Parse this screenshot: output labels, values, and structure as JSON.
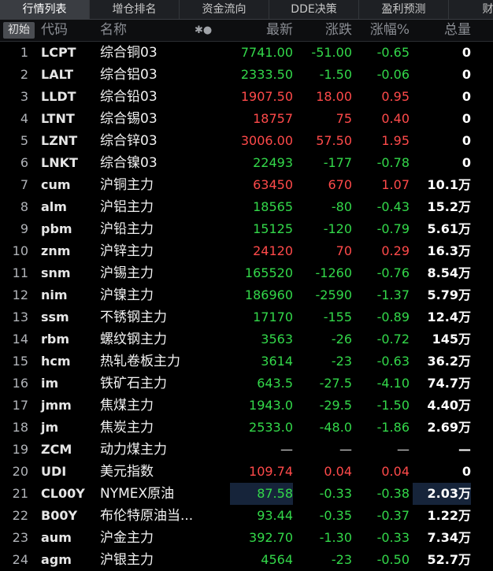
{
  "tabs": [
    "行情列表",
    "增仓排名",
    "资金流向",
    "DDE决策",
    "盈利预测",
    "财务"
  ],
  "header": {
    "init_btn": "初始",
    "code": "代码",
    "name": "名称",
    "icons": "✱●",
    "price": "最新",
    "change": "涨跌",
    "pct": "涨幅%",
    "volume": "总量"
  },
  "colors": {
    "up": "#ff4a4a",
    "down": "#33d84a",
    "highlight": "#16243a"
  },
  "rows": [
    {
      "n": "1",
      "code": "LCPT",
      "name": "综合铜03",
      "price": "7741.00",
      "change": "-51.00",
      "pct": "-0.65",
      "volume": "0",
      "dir": "down"
    },
    {
      "n": "2",
      "code": "LALT",
      "name": "综合铝03",
      "price": "2333.50",
      "change": "-1.50",
      "pct": "-0.06",
      "volume": "0",
      "dir": "down"
    },
    {
      "n": "3",
      "code": "LLDT",
      "name": "综合铅03",
      "price": "1907.50",
      "change": "18.00",
      "pct": "0.95",
      "volume": "0",
      "dir": "up"
    },
    {
      "n": "4",
      "code": "LTNT",
      "name": "综合锡03",
      "price": "18757",
      "change": "75",
      "pct": "0.40",
      "volume": "0",
      "dir": "up"
    },
    {
      "n": "5",
      "code": "LZNT",
      "name": "综合锌03",
      "price": "3006.00",
      "change": "57.50",
      "pct": "1.95",
      "volume": "0",
      "dir": "up"
    },
    {
      "n": "6",
      "code": "LNKT",
      "name": "综合镍03",
      "price": "22493",
      "change": "-177",
      "pct": "-0.78",
      "volume": "0",
      "dir": "down"
    },
    {
      "n": "7",
      "code": "cum",
      "name": "沪铜主力",
      "price": "63450",
      "change": "670",
      "pct": "1.07",
      "volume": "10.1万",
      "dir": "up"
    },
    {
      "n": "8",
      "code": "alm",
      "name": "沪铝主力",
      "price": "18565",
      "change": "-80",
      "pct": "-0.43",
      "volume": "15.2万",
      "dir": "down"
    },
    {
      "n": "9",
      "code": "pbm",
      "name": "沪铅主力",
      "price": "15125",
      "change": "-120",
      "pct": "-0.79",
      "volume": "5.61万",
      "dir": "down"
    },
    {
      "n": "10",
      "code": "znm",
      "name": "沪锌主力",
      "price": "24120",
      "change": "70",
      "pct": "0.29",
      "volume": "16.3万",
      "dir": "up"
    },
    {
      "n": "11",
      "code": "snm",
      "name": "沪锡主力",
      "price": "165520",
      "change": "-1260",
      "pct": "-0.76",
      "volume": "8.54万",
      "dir": "down"
    },
    {
      "n": "12",
      "code": "nim",
      "name": "沪镍主力",
      "price": "186960",
      "change": "-2590",
      "pct": "-1.37",
      "volume": "5.79万",
      "dir": "down"
    },
    {
      "n": "13",
      "code": "ssm",
      "name": "不锈钢主力",
      "price": "17170",
      "change": "-155",
      "pct": "-0.89",
      "volume": "12.4万",
      "dir": "down"
    },
    {
      "n": "14",
      "code": "rbm",
      "name": "螺纹钢主力",
      "price": "3563",
      "change": "-26",
      "pct": "-0.72",
      "volume": "145万",
      "dir": "down"
    },
    {
      "n": "15",
      "code": "hcm",
      "name": "热轧卷板主力",
      "price": "3614",
      "change": "-23",
      "pct": "-0.63",
      "volume": "36.2万",
      "dir": "down"
    },
    {
      "n": "16",
      "code": "im",
      "name": "铁矿石主力",
      "price": "643.5",
      "change": "-27.5",
      "pct": "-4.10",
      "volume": "74.7万",
      "dir": "down"
    },
    {
      "n": "17",
      "code": "jmm",
      "name": "焦煤主力",
      "price": "1943.0",
      "change": "-29.5",
      "pct": "-1.50",
      "volume": "4.40万",
      "dir": "down"
    },
    {
      "n": "18",
      "code": "jm",
      "name": "焦炭主力",
      "price": "2533.0",
      "change": "-48.0",
      "pct": "-1.86",
      "volume": "2.69万",
      "dir": "down"
    },
    {
      "n": "19",
      "code": "ZCM",
      "name": "动力煤主力",
      "price": "—",
      "change": "—",
      "pct": "—",
      "volume": "—",
      "dir": "flat"
    },
    {
      "n": "20",
      "code": "UDI",
      "name": "美元指数",
      "price": "109.74",
      "change": "0.04",
      "pct": "0.04",
      "volume": "0",
      "dir": "up"
    },
    {
      "n": "21",
      "code": "CL00Y",
      "name": "NYMEX原油",
      "price": "87.58",
      "change": "-0.33",
      "pct": "-0.38",
      "volume": "2.03万",
      "dir": "down",
      "highlight": true
    },
    {
      "n": "22",
      "code": "B00Y",
      "name": "布伦特原油当...",
      "price": "93.44",
      "change": "-0.35",
      "pct": "-0.37",
      "volume": "1.22万",
      "dir": "down"
    },
    {
      "n": "23",
      "code": "aum",
      "name": "沪金主力",
      "price": "392.70",
      "change": "-1.30",
      "pct": "-0.33",
      "volume": "7.34万",
      "dir": "down"
    },
    {
      "n": "24",
      "code": "agm",
      "name": "沪银主力",
      "price": "4564",
      "change": "-23",
      "pct": "-0.50",
      "volume": "52.7万",
      "dir": "down"
    }
  ]
}
